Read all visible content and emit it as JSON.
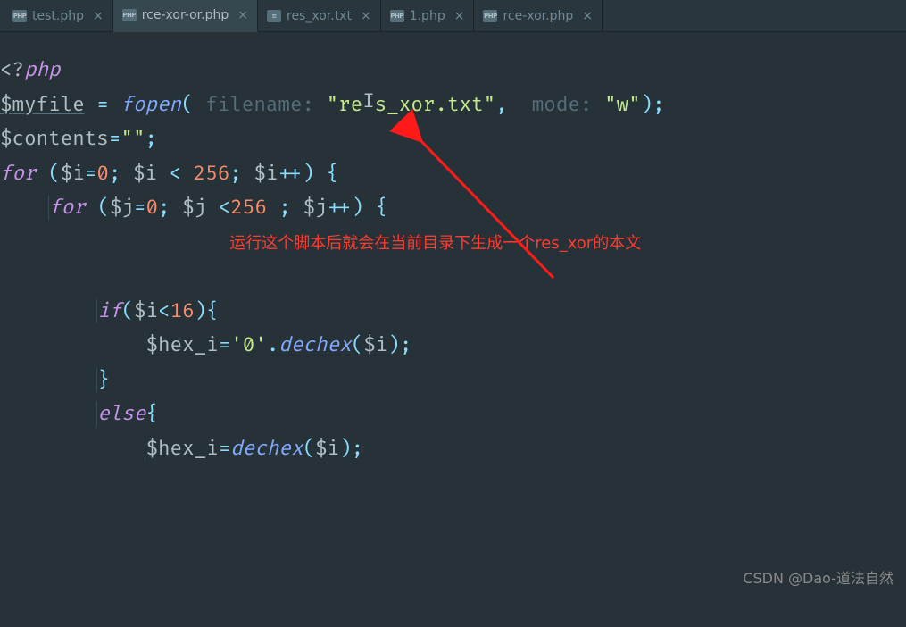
{
  "tabs": [
    {
      "label": "test.php",
      "badge": "PHP",
      "active": false
    },
    {
      "label": "rce-xor-or.php",
      "badge": "PHP",
      "active": true
    },
    {
      "label": "res_xor.txt",
      "badge": "≡",
      "active": false
    },
    {
      "label": "1.php",
      "badge": "PHP",
      "active": false
    },
    {
      "label": "rce-xor.php",
      "badge": "PHP",
      "active": false
    }
  ],
  "close_glyph": "×",
  "code": {
    "l1a": "<?",
    "l1b": "php",
    "l2_var": "$myfile",
    "l2_eq": " = ",
    "l2_fn": "fopen",
    "l2_open": "( ",
    "l2_hint1": "filename: ",
    "l2_str1": "\"res_xor.txt\"",
    "l2_comma": ",  ",
    "l2_hint2": "mode: ",
    "l2_str2": "\"w\"",
    "l2_close": ");",
    "l3_var": "$contents",
    "l3_eq": "=",
    "l3_str": "\"\"",
    "l3_semi": ";",
    "l4_for": "for",
    "l4_rest": " (",
    "l4_var": "$i",
    "l4_eq": "=",
    "l4_zero": "0",
    "l4_semi": "; ",
    "l4_var2": "$i",
    "l4_lt": " < ",
    "l4_num": "256",
    "l4_semi2": "; ",
    "l4_var3": "$i",
    "l4_inc": "++) {",
    "l5_for": "for",
    "l5_rest": " (",
    "l5_var": "$j",
    "l5_eq": "=",
    "l5_zero": "0",
    "l5_semi": "; ",
    "l5_var2": "$j",
    "l5_lt": " <",
    "l5_num": "256",
    "l5_sp": " ; ",
    "l5_var3": "$j",
    "l5_inc": "++) {",
    "annotation": "运行这个脚本后就会在当前目录下生成一个res_xor的本文",
    "l7_if": "if",
    "l7_open": "(",
    "l7_var": "$i",
    "l7_lt": "<",
    "l7_num": "16",
    "l7_close": "){",
    "l8_var": "$hex_i",
    "l8_eq": "=",
    "l8_str": "'0'",
    "l8_dot": ".",
    "l8_fn": "dechex",
    "l8_open": "(",
    "l8_arg": "$i",
    "l8_close": ");",
    "l9": "}",
    "l10_else": "else",
    "l10_brace": "{",
    "l11_var": "$hex_i",
    "l11_eq": "=",
    "l11_fn": "dechex",
    "l11_open": "(",
    "l11_arg": "$i",
    "l11_close": ");"
  },
  "watermark": "CSDN @Dao-道法自然"
}
